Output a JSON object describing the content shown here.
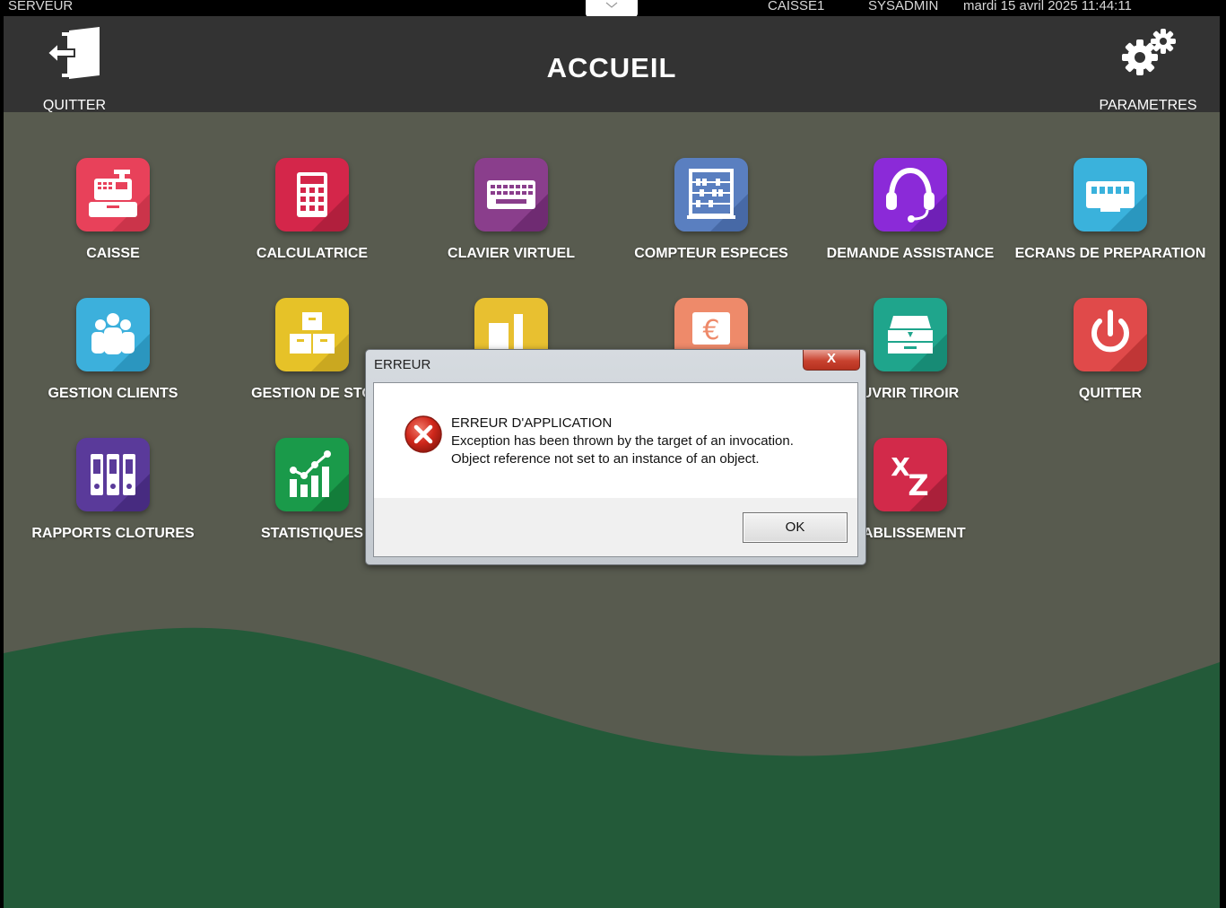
{
  "status_bar": {
    "server": "SERVEUR",
    "register": "CAISSE1",
    "user": "SYSADMIN",
    "datetime": "mardi 15 avril 2025  11:44:11"
  },
  "header": {
    "title": "ACCUEIL",
    "quit_label": "QUITTER",
    "settings_label": "PARAMETRES"
  },
  "tiles": [
    {
      "label": "CAISSE",
      "icon": "cash-register-icon",
      "color": "#e8415a"
    },
    {
      "label": "CALCULATRICE",
      "icon": "calculator-icon",
      "color": "#d4264a"
    },
    {
      "label": "CLAVIER VIRTUEL",
      "icon": "keyboard-icon",
      "color": "#8a3e8c"
    },
    {
      "label": "COMPTEUR ESPECES",
      "icon": "abacus-icon",
      "color": "#5a7fc0"
    },
    {
      "label": "DEMANDE ASSISTANCE",
      "icon": "headset-icon",
      "color": "#8b2ad8"
    },
    {
      "label": "ECRANS DE PREPARATION",
      "icon": "display-icon",
      "color": "#3ab2dc"
    },
    {
      "label": "GESTION CLIENTS",
      "icon": "users-icon",
      "color": "#3cb0dc"
    },
    {
      "label": "GESTION DE STO",
      "icon": "boxes-icon",
      "color": "#e6c228"
    },
    {
      "label": "",
      "icon": "bottles-icon",
      "color": "#e8c030"
    },
    {
      "label": "",
      "icon": "euro-icon",
      "color": "#ee8a6a"
    },
    {
      "label": "UVRIR TIROIR",
      "icon": "drawer-icon",
      "color": "#1fa58c"
    },
    {
      "label": "QUITTER",
      "icon": "power-icon",
      "color": "#e04a4a"
    },
    {
      "label": "RAPPORTS CLOTURES",
      "icon": "binders-icon",
      "color": "#5a3a9a"
    },
    {
      "label": "STATISTIQUES",
      "icon": "bar-chart-icon",
      "color": "#1a9a4a"
    },
    {
      "label": "TABLISSEMENT",
      "icon": "xz-icon",
      "color": "#d22a4a"
    }
  ],
  "dialog": {
    "title": "ERREUR",
    "close_label": "X",
    "heading": "ERREUR D'APPLICATION",
    "line1": "Exception has been thrown by the target of an invocation.",
    "line2": "Object reference not set to an instance of an object.",
    "ok_label": "OK"
  },
  "colors": {
    "background": "#585b4f",
    "header": "#333333",
    "wave": "#235a39"
  }
}
